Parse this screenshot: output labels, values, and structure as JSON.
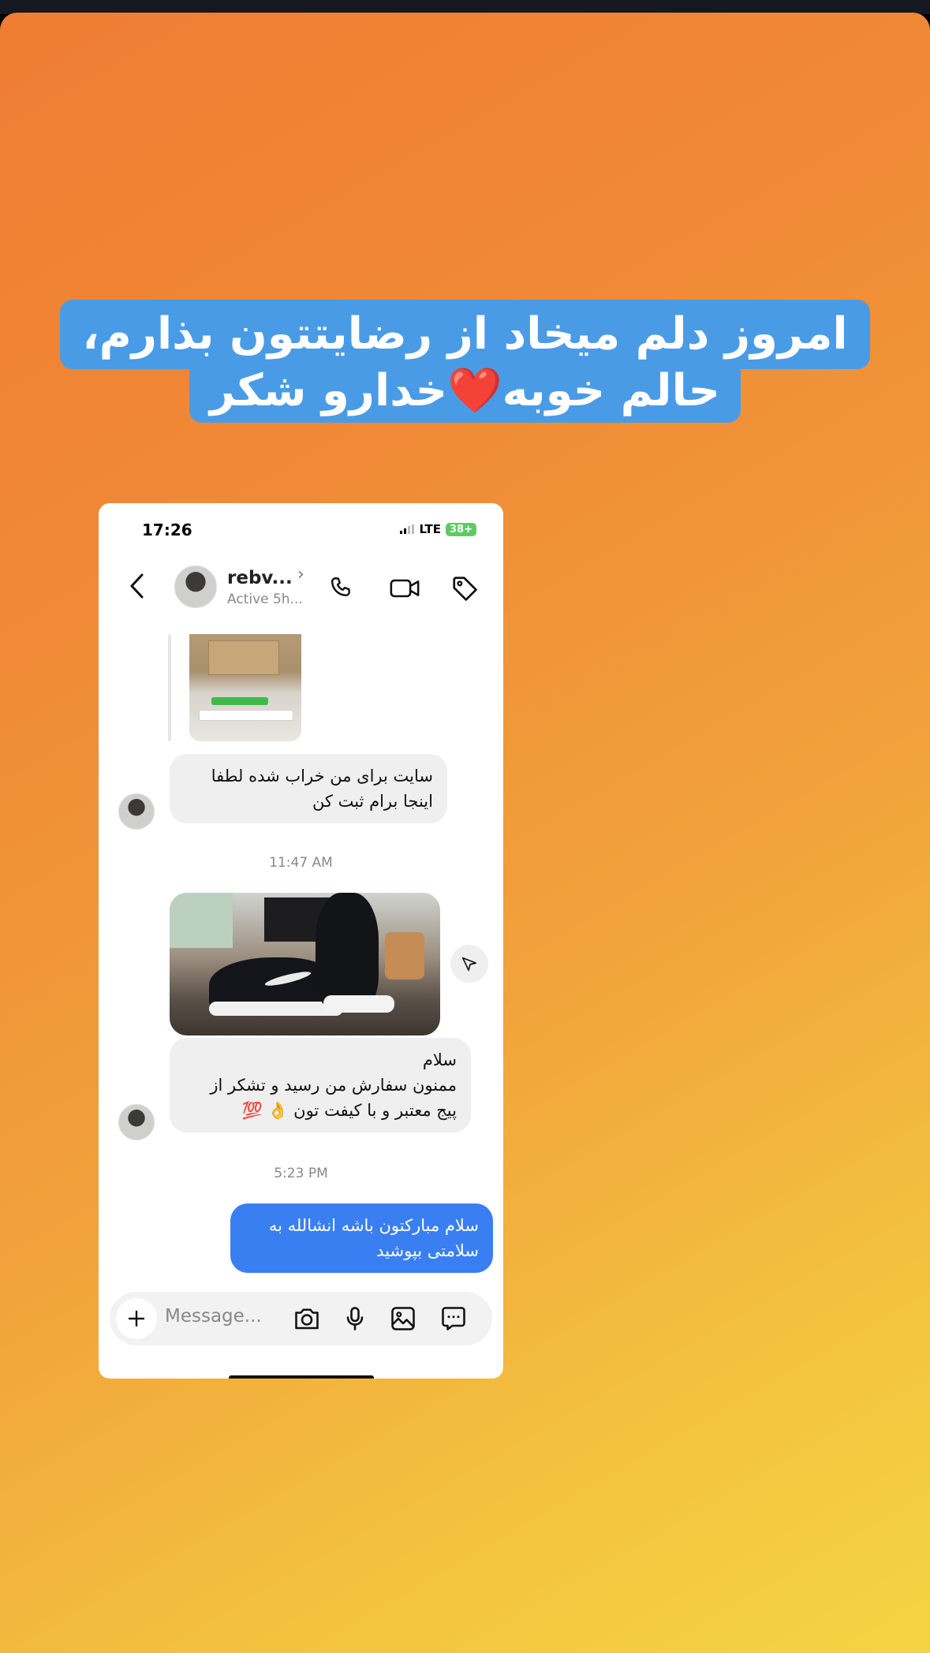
{
  "story": {
    "caption_line1": "امروز دلم میخاد از رضایتتون بذارم،",
    "caption_line2": "حالم خوبه❤️خدارو  شکر"
  },
  "status_bar": {
    "time": "17:26",
    "network": "LTE",
    "battery": "38+"
  },
  "chat_header": {
    "name": "rebv...",
    "status": "Active 5h..."
  },
  "messages": {
    "incoming_1": "سایت برای من خراب شده لطفا\nاینجا برام ثبت کن",
    "time_1": "11:47 AM",
    "incoming_2": "سلام\nممنون سفارش من رسید و تشکر از\nپیج معتبر و با کیفت تون 👌 💯",
    "time_2": "5:23 PM",
    "outgoing_1": "سلام مبارکتون باشه انشالله به\nسلامتی بپوشید"
  },
  "composer": {
    "placeholder": "Message..."
  },
  "colors": {
    "caption_bg": "#4a9be6",
    "outgoing_bubble": "#3a7ff1",
    "incoming_bubble": "#efefef",
    "gradient_start": "#ef7d33",
    "gradient_end": "#f5d443"
  },
  "icons": [
    "back-icon",
    "chevron-right-icon",
    "phone-icon",
    "video-icon",
    "tag-icon",
    "send-icon",
    "plus-icon",
    "camera-icon",
    "microphone-icon",
    "gallery-icon",
    "sticker-icon"
  ]
}
